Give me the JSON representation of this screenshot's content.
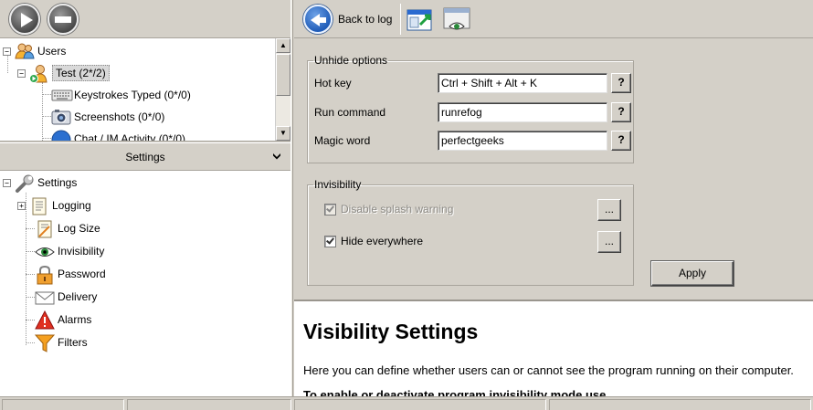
{
  "toolbar_left": {
    "start_icon": "play-icon",
    "stop_icon": "stop-icon"
  },
  "users_tree": {
    "root": {
      "label": "Users",
      "icon": "users-icon"
    },
    "user": {
      "label": "Test (2*/2)",
      "icon": "user-icon"
    },
    "children": [
      {
        "label": "Keystrokes Typed (0*/0)",
        "icon": "keyboard-icon"
      },
      {
        "label": "Screenshots (0*/0)",
        "icon": "camera-icon"
      },
      {
        "label": "Chat / IM Activity (0*/0)",
        "icon": "chat-icon"
      }
    ]
  },
  "settings_header": {
    "label": "Settings"
  },
  "settings_tree": {
    "root": {
      "label": "Settings",
      "icon": "wrench-icon"
    },
    "items": [
      {
        "label": "Logging",
        "icon": "scroll-icon"
      },
      {
        "label": "Log Size",
        "icon": "log-size-icon"
      },
      {
        "label": "Invisibility",
        "icon": "eye-icon"
      },
      {
        "label": "Password",
        "icon": "lock-icon"
      },
      {
        "label": "Delivery",
        "icon": "envelope-icon"
      },
      {
        "label": "Alarms",
        "icon": "alarm-icon"
      },
      {
        "label": "Filters",
        "icon": "funnel-icon"
      }
    ]
  },
  "toolbar_right": {
    "back_label": "Back to log",
    "icons": [
      "window-export-icon",
      "window-eye-icon"
    ]
  },
  "unhide_options": {
    "legend": "Unhide options",
    "hotkey": {
      "label": "Hot key",
      "value": "Ctrl + Shift + Alt + K"
    },
    "run_command": {
      "label": "Run command",
      "value": "runrefog"
    },
    "magic_word": {
      "label": "Magic word",
      "value": "perfectgeeks"
    },
    "help_button": "?"
  },
  "invisibility": {
    "legend": "Invisibility",
    "disable_splash": {
      "label": "Disable splash warning",
      "checked": true,
      "enabled": false
    },
    "hide_everywhere": {
      "label": "Hide everywhere",
      "checked": true,
      "enabled": true
    },
    "dots_button": "..."
  },
  "apply_label": "Apply",
  "help_panel": {
    "title": "Visibility Settings",
    "paragraph1": "Here you can define whether users can or cannot see the program running on their computer.",
    "paragraph2": "To enable or deactivate program invisibility mode use"
  }
}
